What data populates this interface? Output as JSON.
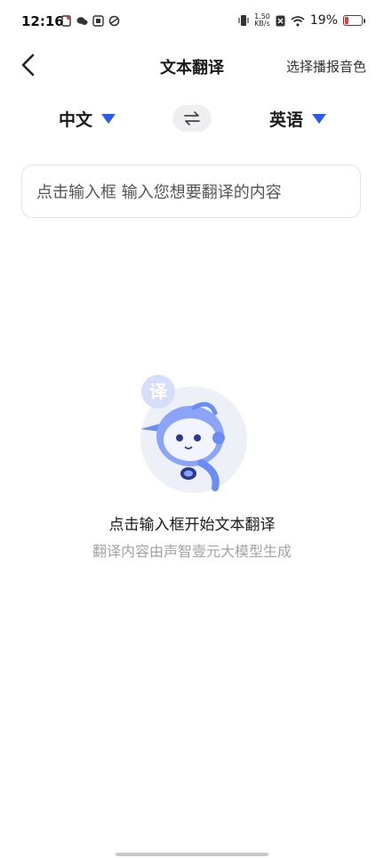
{
  "status_bar": {
    "time": "12:16",
    "net_speed_value": "1.50",
    "net_speed_unit": "KB/s",
    "battery_percent": "19%"
  },
  "header": {
    "title": "文本翻译",
    "right_action": "选择播报音色"
  },
  "languages": {
    "source": "中文",
    "target": "英语"
  },
  "input": {
    "placeholder": "点击输入框 输入您想要翻译的内容"
  },
  "empty_state": {
    "badge": "译",
    "title": "点击输入框开始文本翻译",
    "subtitle": "翻译内容由声智壹元大模型生成"
  },
  "colors": {
    "accent": "#2a5cf0",
    "battery_low": "#e23b3b"
  }
}
